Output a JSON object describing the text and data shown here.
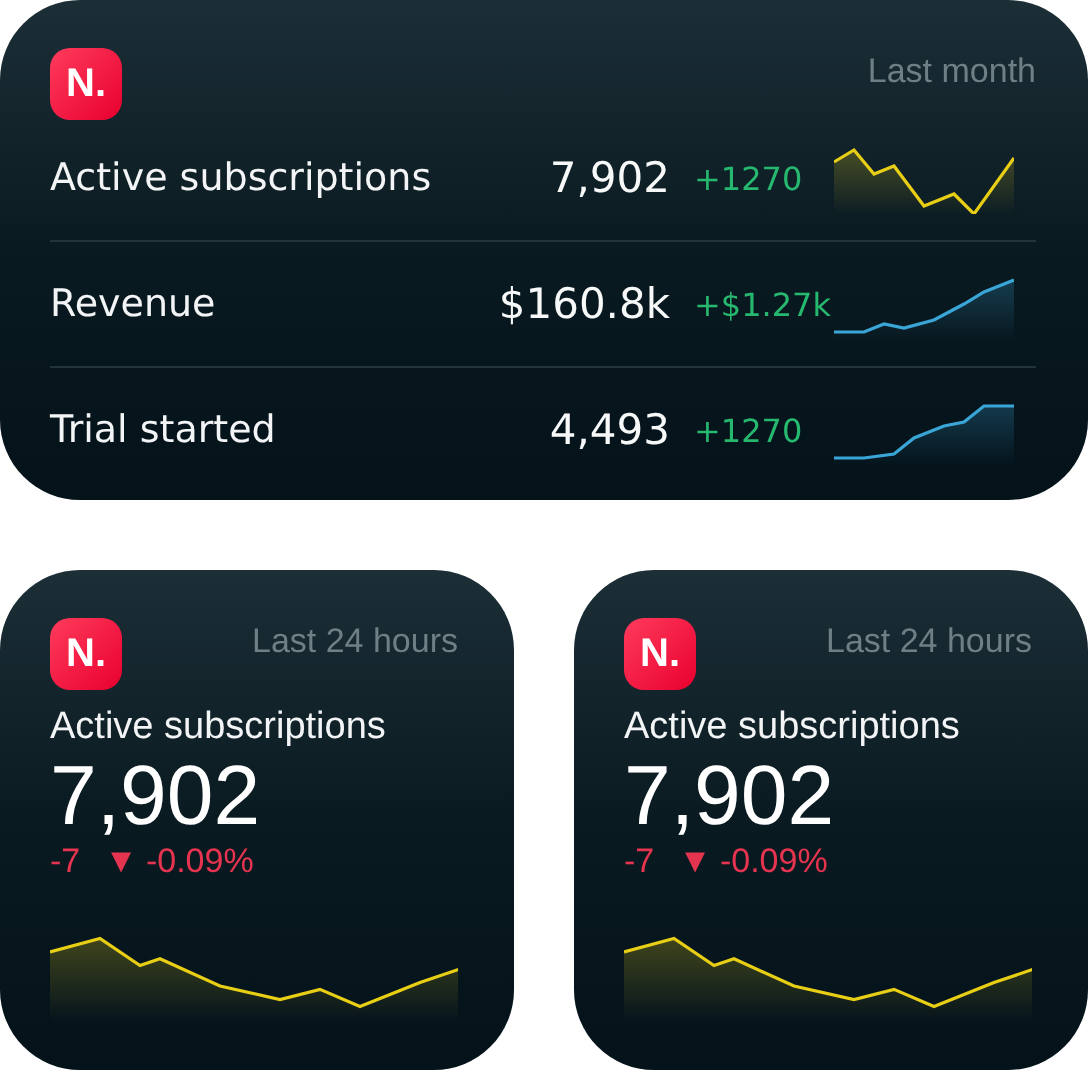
{
  "summary_widget": {
    "logo": "N.",
    "period": "Last month",
    "metrics": [
      {
        "label": "Active subscriptions",
        "value": "7,902",
        "change": "+1270",
        "color": "#e8cf16"
      },
      {
        "label": "Revenue",
        "value": "$160.8k",
        "change": "+$1.27k",
        "color": "#3aa6d8"
      },
      {
        "label": "Trial started",
        "value": "4,493",
        "change": "+1270",
        "color": "#3aa6d8"
      }
    ]
  },
  "small_widgets": [
    {
      "logo": "N.",
      "period": "Last 24 hours",
      "label": "Active subscriptions",
      "value": "7,902",
      "change": "-7",
      "arrow": "▼",
      "percent": "-0.09%",
      "color": "#e8cf16"
    },
    {
      "logo": "N.",
      "period": "Last 24 hours",
      "label": "Active subscriptions",
      "value": "7,902",
      "change": "-7",
      "arrow": "▼",
      "percent": "-0.09%",
      "color": "#e8cf16"
    }
  ]
}
